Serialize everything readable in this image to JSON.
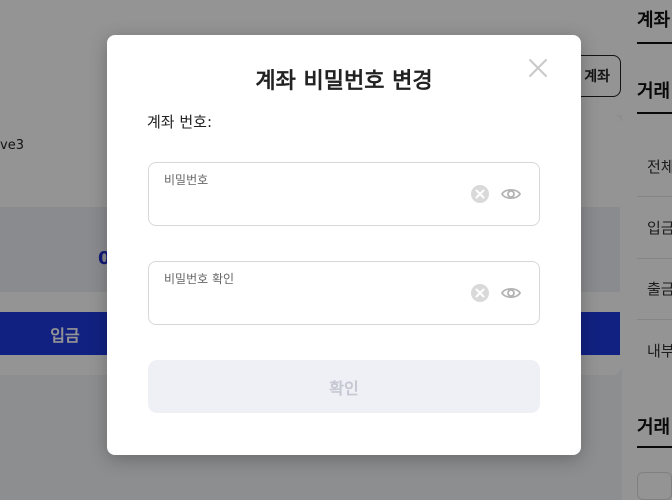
{
  "background": {
    "account_button_label": "계좌",
    "card_text": "ve3",
    "balance_value": "0",
    "deposit_button_label": "입금",
    "sidebar": {
      "section_title_1": "계좌",
      "section_title_2": "거래",
      "items": [
        "전체",
        "입금",
        "출금",
        "내부"
      ],
      "section_title_3": "거래"
    }
  },
  "modal": {
    "title": "계좌 비밀번호 변경",
    "account_label": "계좌 번호:",
    "account_value": "",
    "password_field": {
      "label": "비밀번호",
      "value": ""
    },
    "password_confirm_field": {
      "label": "비밀번호 확인",
      "value": ""
    },
    "confirm_button_label": "확인"
  },
  "colors": {
    "primary_blue": "#1e3adf",
    "disabled_button_bg": "#eff0f5",
    "disabled_button_text": "#c5c7d2",
    "overlay": "rgba(0,0,0,0.42)"
  },
  "icons": {
    "close": "close-icon",
    "clear": "clear-icon",
    "toggle_visibility": "eye-icon"
  }
}
